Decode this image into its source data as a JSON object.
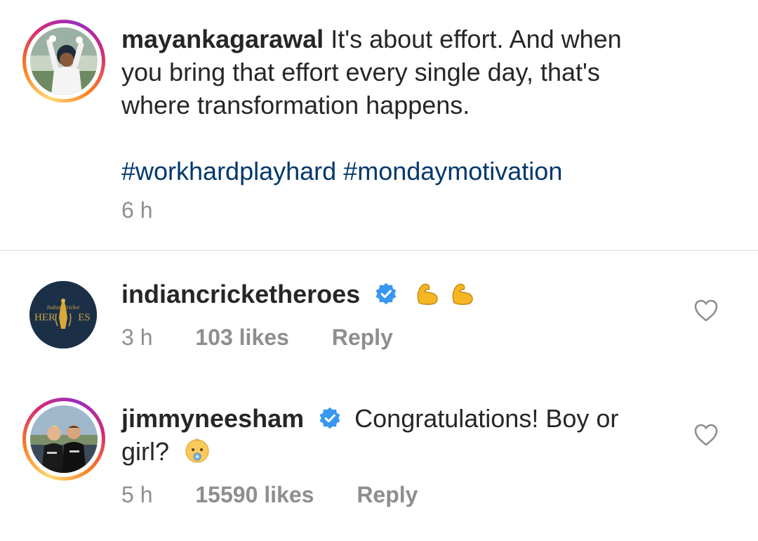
{
  "caption": {
    "username": "mayankagarawal",
    "text_line1": "It's about effort. And when",
    "text_line2": "you bring that effort every single day, that's",
    "text_line3": "where transformation happens.",
    "hashtags": "#workhardplayhard #mondaymotivation",
    "time": "6 h",
    "avatar_icon": "cricketer-avatar"
  },
  "comments": [
    {
      "username": "indiancricketheroes",
      "verified": true,
      "text": "",
      "emoji": "flexed-biceps-emoji x2",
      "time": "3 h",
      "likes": "103 likes",
      "reply_label": "Reply",
      "avatar_text_small": "Indian Cricket",
      "avatar_text_big_left": "HER",
      "avatar_text_big_right": "ES"
    },
    {
      "username": "jimmyneesham",
      "verified": true,
      "text_line1": "Congratulations! Boy or",
      "text_line2": "girl?",
      "emoji": "baby-emoji",
      "time": "5 h",
      "likes": "15590 likes",
      "reply_label": "Reply"
    }
  ],
  "colors": {
    "text": "#262626",
    "secondary": "#8e8e8e",
    "hashtag": "#00376b",
    "verified": "#3897f0",
    "divider": "#dbdbdb"
  }
}
